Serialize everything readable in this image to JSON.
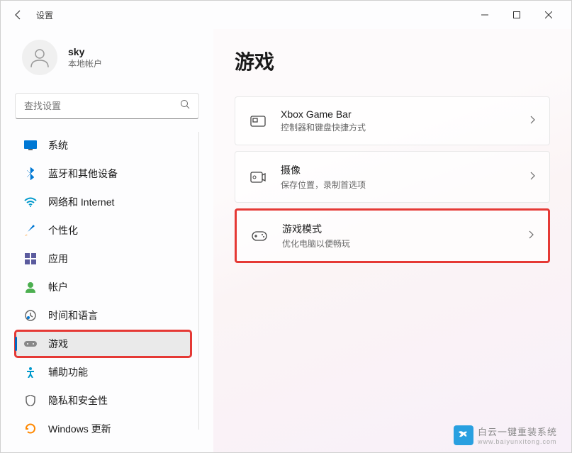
{
  "window": {
    "title": "设置"
  },
  "user": {
    "name": "sky",
    "type": "本地帐户"
  },
  "search": {
    "placeholder": "查找设置"
  },
  "nav": {
    "items": [
      {
        "label": "系统"
      },
      {
        "label": "蓝牙和其他设备"
      },
      {
        "label": "网络和 Internet"
      },
      {
        "label": "个性化"
      },
      {
        "label": "应用"
      },
      {
        "label": "帐户"
      },
      {
        "label": "时间和语言"
      },
      {
        "label": "游戏"
      },
      {
        "label": "辅助功能"
      },
      {
        "label": "隐私和安全性"
      },
      {
        "label": "Windows 更新"
      }
    ]
  },
  "page": {
    "title": "游戏",
    "cards": [
      {
        "title": "Xbox Game Bar",
        "subtitle": "控制器和键盘快捷方式"
      },
      {
        "title": "摄像",
        "subtitle": "保存位置，录制首选项"
      },
      {
        "title": "游戏模式",
        "subtitle": "优化电脑以便畅玩"
      }
    ]
  },
  "watermark": {
    "title": "白云一键重装系统",
    "url": "www.baiyunxitong.com"
  }
}
